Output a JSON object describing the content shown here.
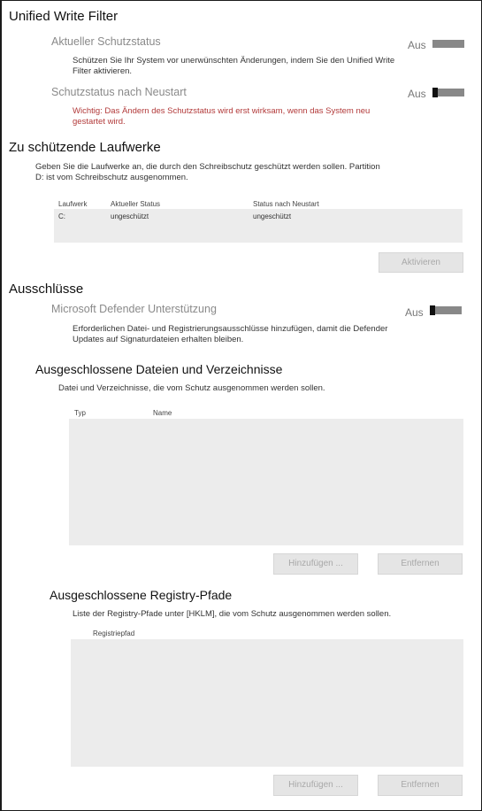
{
  "uwf": {
    "title": "Unified Write Filter",
    "current_status": {
      "label": "Aktueller Schutzstatus",
      "description": "Schützen Sie Ihr System vor unerwünschten Änderungen, indem Sie den Unified Write Filter aktivieren.",
      "state": "Aus"
    },
    "after_restart": {
      "label": "Schutzstatus nach Neustart",
      "warning": "Wichtig: Das Ändern des Schutzstatus wird erst wirksam, wenn das System neu gestartet wird.",
      "state": "Aus"
    }
  },
  "drives": {
    "title": "Zu schützende Laufwerke",
    "description": "Geben Sie die Laufwerke an, die durch den Schreibschutz geschützt werden sollen. Partition D: ist vom Schreibschutz ausgenommen.",
    "columns": [
      "Laufwerk",
      "Aktueller Status",
      "Status nach Neustart"
    ],
    "rows": [
      {
        "drive": "C:",
        "current": "ungeschützt",
        "after": "ungeschützt"
      }
    ],
    "activate_button": "Aktivieren"
  },
  "exclusions": {
    "title": "Ausschlüsse",
    "defender": {
      "label": "Microsoft Defender Unterstützung",
      "description": "Erforderlichen Datei- und Registrierungsausschlüsse hinzufügen, damit die Defender Updates auf Signaturdateien erhalten bleiben.",
      "state": "Aus"
    },
    "files": {
      "title": "Ausgeschlossene Dateien und Verzeichnisse",
      "description": "Datei und Verzeichnisse, die vom Schutz ausgenommen werden sollen.",
      "columns": [
        "Typ",
        "Name"
      ],
      "add_button": "Hinzufügen ...",
      "remove_button": "Entfernen"
    },
    "registry": {
      "title": "Ausgeschlossene Registry-Pfade",
      "description": "Liste der Registry-Pfade unter [HKLM], die vom Schutz ausgenommen werden sollen.",
      "columns": [
        "Registriepfad"
      ],
      "add_button": "Hinzufügen ...",
      "remove_button": "Entfernen"
    }
  }
}
